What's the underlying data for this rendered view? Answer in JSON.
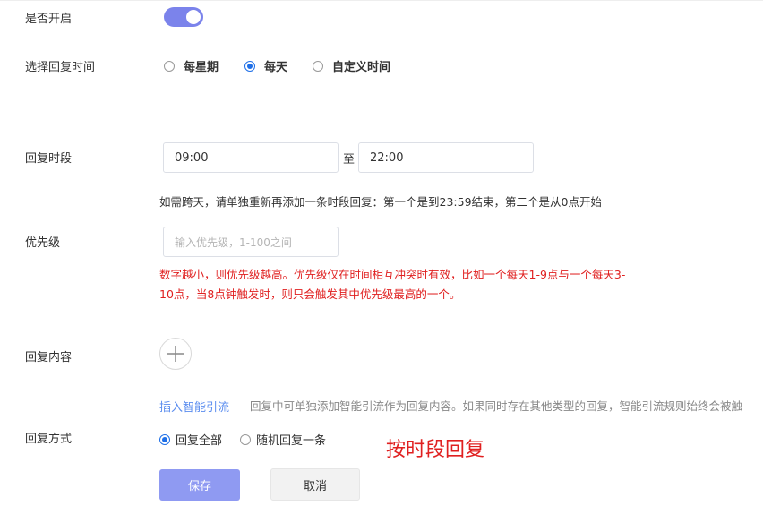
{
  "enabled": {
    "label": "是否开启",
    "value": true
  },
  "reply_time": {
    "label": "选择回复时间",
    "options": [
      "每星期",
      "每天",
      "自定义时间"
    ],
    "selected": "每天"
  },
  "period": {
    "label": "回复时段",
    "start": "09:00",
    "separator": "至",
    "end": "22:00",
    "note": "如需跨天，请单独重新再添加一条时段回复：第一个是到23:59结束，第二个是从0点开始"
  },
  "priority": {
    "label": "优先级",
    "placeholder": "输入优先级，1-100之间",
    "warning_line1": "数字越小，则优先级越高。优先级仅在时间相互冲突时有效，比如一个每天1-9点与一个每天3-",
    "warning_line2": "10点，当8点钟触发时，则只会触发其中优先级最高的一个。"
  },
  "content": {
    "label": "回复内容",
    "add_icon": "plus-icon",
    "link": "插入智能引流",
    "hint": "回复中可单独添加智能引流作为回复内容。如果同时存在其他类型的回复，智能引流规则始终会被触"
  },
  "method": {
    "label": "回复方式",
    "options": [
      "回复全部",
      "随机回复一条"
    ],
    "selected": "回复全部"
  },
  "mode_title": "按时段回复",
  "actions": {
    "save": "保存",
    "cancel": "取消"
  },
  "colors": {
    "accent": "#7b83eb",
    "radio": "#1e6fe8",
    "warning": "#e02020",
    "link": "#5b8def"
  }
}
